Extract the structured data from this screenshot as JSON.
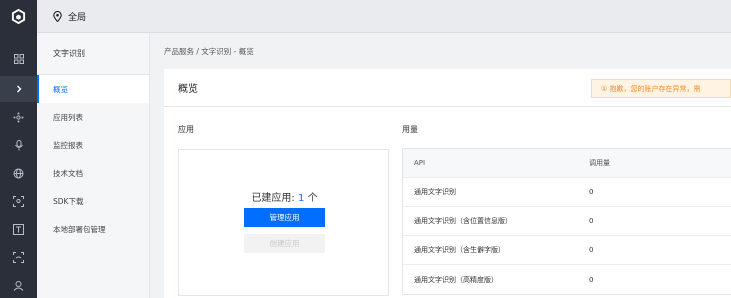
{
  "topbar": {
    "region": "全局"
  },
  "menu": {
    "title": "文字识别",
    "items": [
      {
        "label": "概览",
        "active": true
      },
      {
        "label": "应用列表",
        "active": false
      },
      {
        "label": "监控报表",
        "active": false
      },
      {
        "label": "技术文档",
        "active": false
      },
      {
        "label": "SDK下载",
        "active": false
      },
      {
        "label": "本地部署包管理",
        "active": false
      }
    ]
  },
  "breadcrumb": "产品服务 / 文字识别 - 概览",
  "card": {
    "title": "概览",
    "alert": "① 抱歉，您的账户存在异常，需",
    "app_section": "应用",
    "usage_section": "用量",
    "app_count_prefix": "已建应用:",
    "app_count": "1",
    "app_count_suffix": "个",
    "manage_button": "管理应用",
    "create_button": "创建应用"
  },
  "usage_table": {
    "columns": [
      "API",
      "调用量"
    ],
    "rows": [
      {
        "api": "通用文字识别",
        "amount": "0"
      },
      {
        "api": "通用文字识别（含位置信息版）",
        "amount": "0"
      },
      {
        "api": "通用文字识别（含生僻字版）",
        "amount": "0"
      },
      {
        "api": "通用文字识别（高精度版）",
        "amount": "0"
      }
    ]
  }
}
